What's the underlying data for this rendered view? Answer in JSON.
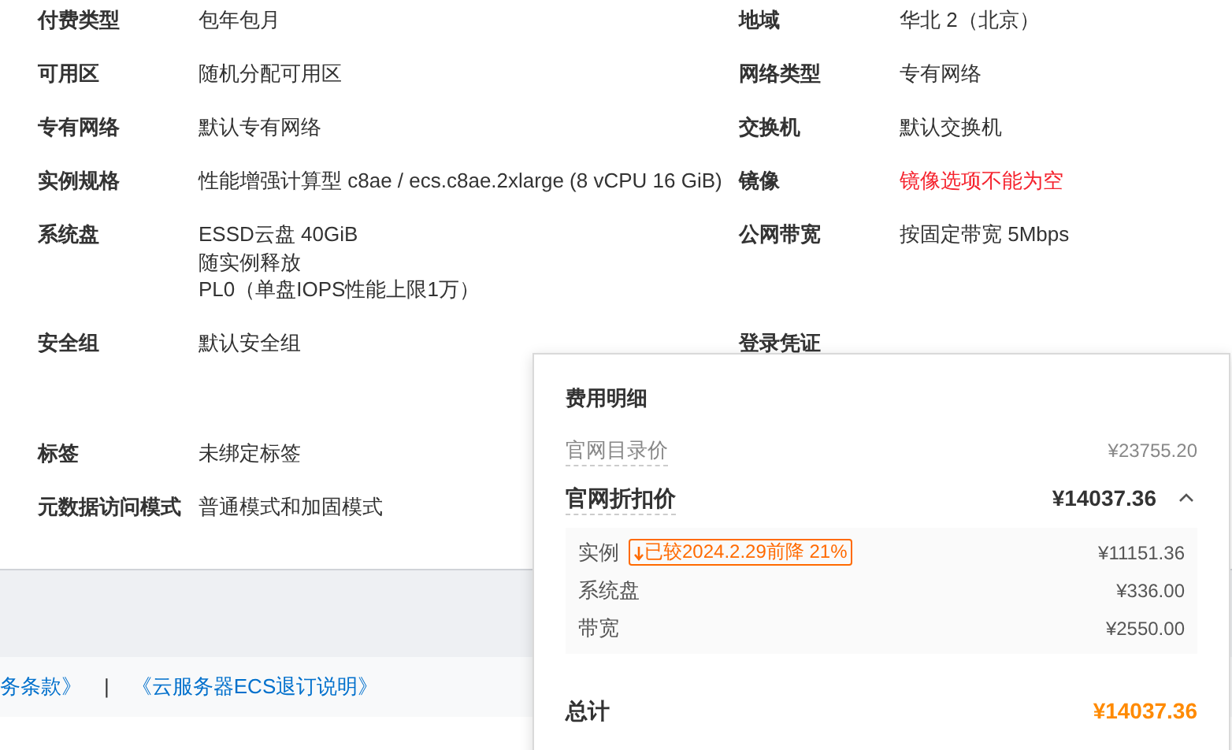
{
  "details": [
    {
      "left": {
        "label": "付费类型",
        "lines": [
          "包年包月"
        ],
        "error": false
      },
      "right": {
        "label": "地域",
        "lines": [
          "华北 2（北京）"
        ],
        "error": false
      }
    },
    {
      "left": {
        "label": "可用区",
        "lines": [
          "随机分配可用区"
        ],
        "error": false
      },
      "right": {
        "label": "网络类型",
        "lines": [
          "专有网络"
        ],
        "error": false
      }
    },
    {
      "left": {
        "label": "专有网络",
        "lines": [
          "默认专有网络"
        ],
        "error": false
      },
      "right": {
        "label": "交换机",
        "lines": [
          "默认交换机"
        ],
        "error": false
      }
    },
    {
      "left": {
        "label": "实例规格",
        "lines": [
          "性能增强计算型 c8ae / ecs.c8ae.2xlarge (8 vCPU 16 GiB)"
        ],
        "error": false
      },
      "right": {
        "label": "镜像",
        "lines": [
          "镜像选项不能为空"
        ],
        "error": true
      }
    },
    {
      "left": {
        "label": "系统盘",
        "lines": [
          "ESSD云盘 40GiB",
          "随实例释放",
          "PL0（单盘IOPS性能上限1万）"
        ],
        "error": false
      },
      "right": {
        "label": "公网带宽",
        "lines": [
          "按固定带宽 5Mbps"
        ],
        "error": false
      }
    },
    {
      "left": {
        "label": "安全组",
        "lines": [
          "默认安全组"
        ],
        "error": false
      },
      "right": {
        "label": "登录凭证"
      }
    },
    {
      "left": {
        "label": "标签",
        "lines": [
          "未绑定标签"
        ],
        "error": false
      }
    },
    {
      "left": {
        "label": "元数据访问模式",
        "lines": [
          "普通模式和加固模式"
        ],
        "error": false
      }
    }
  ],
  "footer": {
    "links": [
      "务条款》",
      "《云服务器ECS退订说明》"
    ],
    "separator": "|"
  },
  "cost_popup": {
    "title": "费用明细",
    "list_price": {
      "label": "官网目录价",
      "amount": "¥23755.20"
    },
    "discount_price": {
      "label": "官网折扣价",
      "amount": "¥14037.36",
      "expanded": true
    },
    "items": [
      {
        "label": "实例",
        "badge": "已较2024.2.29前降 21%",
        "amount": "¥11151.36"
      },
      {
        "label": "系统盘",
        "amount": "¥336.00"
      },
      {
        "label": "带宽",
        "amount": "¥2550.00"
      }
    ],
    "total": {
      "label": "总计",
      "amount": "¥14037.36"
    }
  }
}
